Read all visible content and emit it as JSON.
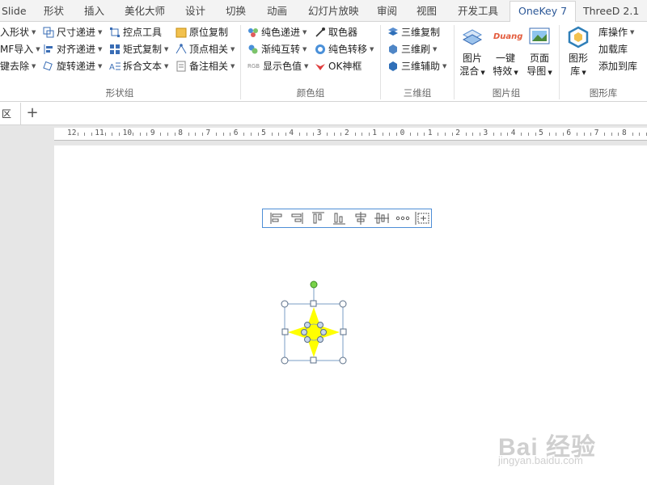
{
  "tabs": [
    {
      "label": "Slide"
    },
    {
      "label": "形状"
    },
    {
      "label": "插入"
    },
    {
      "label": "美化大师"
    },
    {
      "label": "设计"
    },
    {
      "label": "切换"
    },
    {
      "label": "动画"
    },
    {
      "label": "幻灯片放映"
    },
    {
      "label": "审阅"
    },
    {
      "label": "视图"
    },
    {
      "label": "开发工具"
    },
    {
      "label": "OneKey 7",
      "active": true
    },
    {
      "label": "ThreeD 2.1"
    }
  ],
  "groups": {
    "shape": {
      "label": "形状组",
      "col1": [
        "入形状",
        "MF导入",
        "键去除"
      ],
      "col2": [
        "尺寸递进",
        "对齐递进",
        "旋转递进"
      ],
      "col3": [
        "控点工具",
        "矩式复制",
        "拆合文本"
      ],
      "col4": [
        "原位复制",
        "顶点相关",
        "备注相关"
      ]
    },
    "color": {
      "label": "颜色组",
      "col1": [
        "纯色递进",
        "渐纯互转",
        "显示色值"
      ],
      "col2": [
        "取色器",
        "纯色转移",
        "OK神框"
      ]
    },
    "threed": {
      "label": "三维组",
      "items": [
        "三维复制",
        "三维刷",
        "三维辅助"
      ]
    },
    "image": {
      "label": "图片组",
      "btn1": [
        "图片",
        "混合"
      ],
      "btn2": [
        "一键",
        "特效"
      ],
      "btn2_logo": "Duang",
      "btn3": [
        "页面",
        "导图"
      ]
    },
    "library": {
      "label": "图形库",
      "btn": [
        "图形",
        "库"
      ],
      "items": [
        "库操作",
        "加载库",
        "添加到库"
      ]
    }
  },
  "docstrip": {
    "tab_label": "区",
    "plus": "+"
  },
  "ruler": {
    "labels": [
      "12",
      "11",
      "10",
      "9",
      "8",
      "7",
      "6",
      "5",
      "4",
      "3",
      "2",
      "1",
      "0",
      "1",
      "2",
      "3",
      "4",
      "5",
      "6",
      "7",
      "8"
    ]
  },
  "align_toolbar": {
    "icons": [
      "align-left-icon",
      "align-right-icon",
      "align-top-icon",
      "align-bottom-icon",
      "align-center-icon",
      "align-middle-icon",
      "distribute-icon",
      "size-icon"
    ]
  },
  "watermark": {
    "logo": "Bai 经验",
    "url": "jingyan.baidu.com"
  },
  "colors": {
    "accent": "#2b5797",
    "star": "#ffff00",
    "toolbar_border": "#4e8ed6"
  }
}
